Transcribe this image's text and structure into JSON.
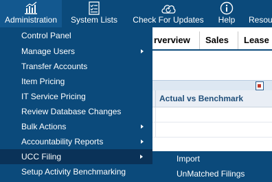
{
  "toolbar": {
    "items": [
      {
        "label": "Administration",
        "icon": "bar-chart-icon"
      },
      {
        "label": "System Lists",
        "icon": "checklist-icon"
      },
      {
        "label": "Check For Updates",
        "icon": "cloud-refresh-icon"
      },
      {
        "label": "Help",
        "icon": "info-icon"
      },
      {
        "label": "Resou"
      }
    ]
  },
  "tabs": [
    "rverview",
    "Sales",
    "Lease"
  ],
  "grid": {
    "column_header": "Actual vs Benchmark"
  },
  "admin_menu": {
    "items": [
      {
        "label": "Control Panel",
        "has_submenu": false
      },
      {
        "label": "Manage Users",
        "has_submenu": true
      },
      {
        "label": "Transfer Accounts",
        "has_submenu": false
      },
      {
        "label": "Item Pricing",
        "has_submenu": false
      },
      {
        "label": "IT Service Pricing",
        "has_submenu": false
      },
      {
        "label": "Review Database Changes",
        "has_submenu": false
      },
      {
        "label": "Bulk Actions",
        "has_submenu": true
      },
      {
        "label": "Accountability Reports",
        "has_submenu": true
      },
      {
        "label": "UCC Filing",
        "has_submenu": true,
        "selected": true
      },
      {
        "label": "Setup Activity Benchmarking",
        "has_submenu": false
      }
    ]
  },
  "ucc_submenu": {
    "items": [
      {
        "label": "Import"
      },
      {
        "label": "UnMatched Filings"
      }
    ]
  },
  "colors": {
    "menu_bg": "#0b4a7b",
    "menu_selected": "#0a3258",
    "header_text": "#1f4e79"
  }
}
